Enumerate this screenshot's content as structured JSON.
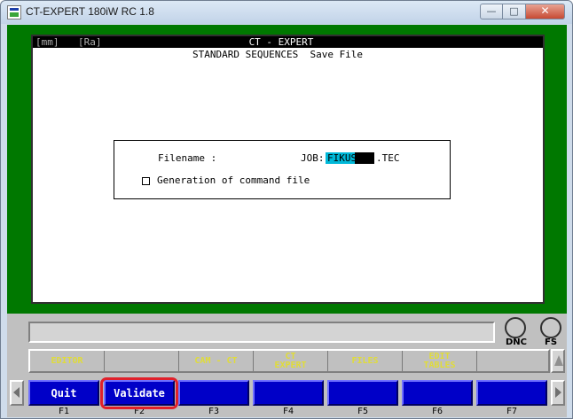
{
  "window": {
    "title": "CT-EXPERT 180iW RC 1.8",
    "minimize_glyph": "—",
    "maximize_glyph": "□",
    "close_glyph": "✕"
  },
  "screen": {
    "unit_mm": "[mm]",
    "unit_ra": "[Ra]",
    "app_name": "CT - EXPERT",
    "subtitle": "STANDARD SEQUENCES  Save File"
  },
  "dialog": {
    "filename_label": "Filename :",
    "filename_prefix": "JOB:",
    "filename_value": "FIKUS",
    "filename_ext": ".TEC",
    "checkbox_label": "Generation of command file",
    "checkbox_checked": false
  },
  "indicators": [
    {
      "label": "DNC"
    },
    {
      "label": "FS"
    }
  ],
  "softkeys": [
    {
      "line1": "EDITOR",
      "line2": ""
    },
    {
      "line1": "",
      "line2": ""
    },
    {
      "line1": "CAM - CT",
      "line2": ""
    },
    {
      "line1": "CT",
      "line2": "EXPERT"
    },
    {
      "line1": "FILES",
      "line2": ""
    },
    {
      "line1": "EDIT",
      "line2": "TABLES"
    },
    {
      "line1": "",
      "line2": ""
    }
  ],
  "function_keys": [
    {
      "label": "Quit",
      "key": "F1"
    },
    {
      "label": "Validate",
      "key": "F2"
    },
    {
      "label": "",
      "key": "F3"
    },
    {
      "label": "",
      "key": "F4"
    },
    {
      "label": "",
      "key": "F5"
    },
    {
      "label": "",
      "key": "F6"
    },
    {
      "label": "",
      "key": "F7"
    }
  ],
  "colors": {
    "background_frame": "#007800",
    "softkey_text": "#e0dc38",
    "function_key": "#0000c8",
    "input_highlight": "#00b8d8",
    "annotation": "#e0202a"
  }
}
